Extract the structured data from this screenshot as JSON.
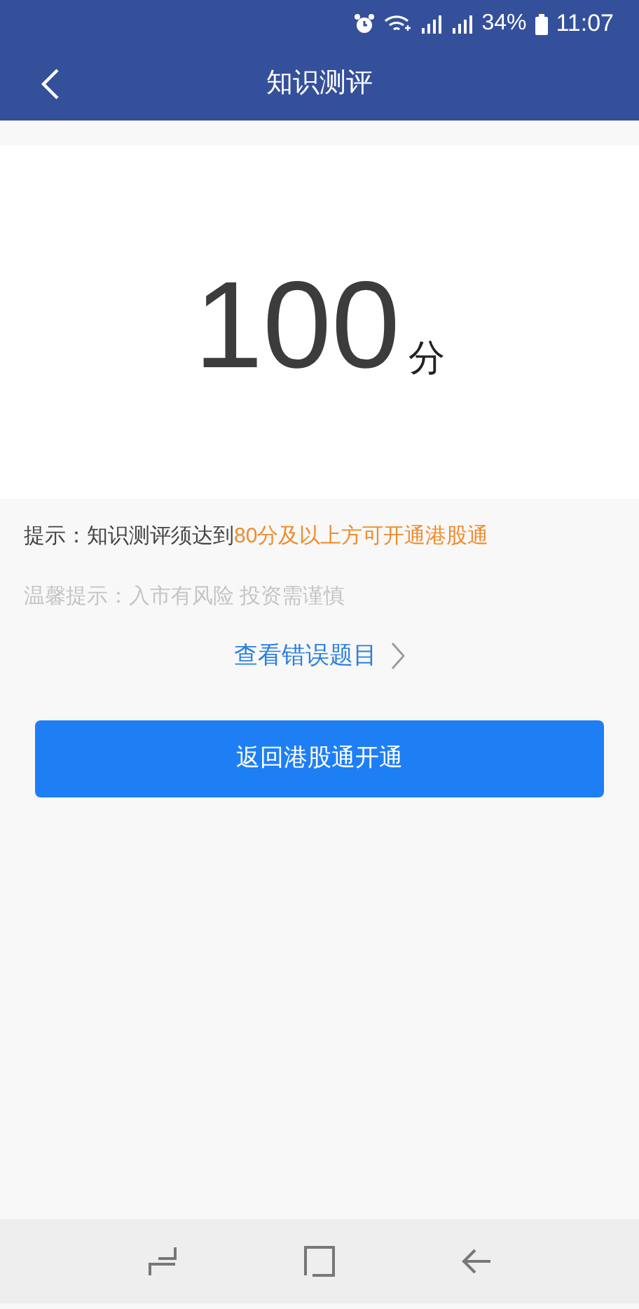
{
  "status_bar": {
    "battery": "34%",
    "time": "11:07"
  },
  "header": {
    "title": "知识测评"
  },
  "score": {
    "value": "100",
    "unit": "分"
  },
  "hint": {
    "text": "提示：知识测评须达到",
    "highlight": "80分及以上方可开通港股通"
  },
  "warm_tip": "温馨提示：入市有风险 投资需谨慎",
  "review_link": "查看错误题目",
  "primary_button": "返回港股通开通"
}
